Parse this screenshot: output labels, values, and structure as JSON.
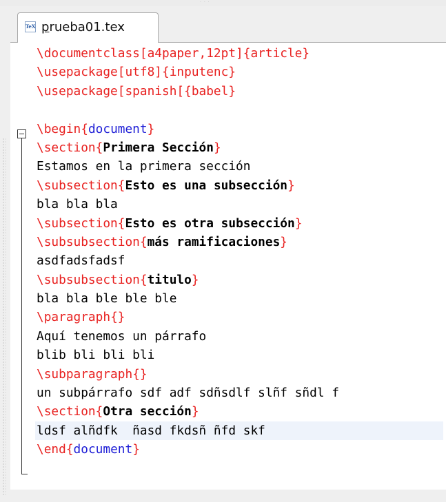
{
  "tab": {
    "icon_text": "TeX",
    "file_name_first": "p",
    "file_name_rest": "rueba01.tex"
  },
  "code": {
    "l1_cmd": "\\documentclass",
    "l1_rest": "[a4paper,12pt]{article}",
    "l2_cmd": "\\usepackage",
    "l2_rest": "[utf8]{inputenc}",
    "l3_cmd": "\\usepackage",
    "l3_rest": "[spanish[{babel}",
    "l5_cmd": "\\begin",
    "l5_open": "{",
    "l5_arg": "document",
    "l5_close": "}",
    "l6_cmd": "\\section",
    "l6_open": "{",
    "l6_arg": "Primera Sección",
    "l6_close": "}",
    "l7_text": "Estamos en la primera sección",
    "l8_cmd": "\\subsection",
    "l8_open": "{",
    "l8_arg": "Esto es una subsección",
    "l8_close": "}",
    "l9_text": "bla bla bla",
    "l10_cmd": "\\subsection",
    "l10_open": "{",
    "l10_arg": "Esto es otra subsección",
    "l10_close": "}",
    "l11_cmd": "\\subsubsection",
    "l11_open": "{",
    "l11_arg": "más ramificaciones",
    "l11_close": "}",
    "l12_text": "asdfadsfadsf",
    "l13_cmd": "\\subsubsection",
    "l13_open": "{",
    "l13_arg": "titulo",
    "l13_close": "}",
    "l14_text": "bla bla ble ble ble",
    "l15_cmd": "\\paragraph",
    "l15_braces": "{}",
    "l16_text": "Aquí tenemos un párrafo",
    "l17_text": "blib bli bli bli",
    "l18_cmd": "\\subparagraph",
    "l18_braces": "{}",
    "l19_text": "un subpárrafo sdf adf sdñsdlf slñf sñdl f",
    "l20_cmd": "\\section",
    "l20_open": "{",
    "l20_arg": "Otra sección",
    "l20_close": "}",
    "l21_text": "ldsf alñdfk  ñasd fkdsñ ñfd skf",
    "l22_cmd": "\\end",
    "l22_open": "{",
    "l22_arg": "document",
    "l22_close": "}"
  },
  "colors": {
    "command": "#e8201f",
    "argument": "#1d1dd6",
    "current_line": "#eef3fb"
  }
}
